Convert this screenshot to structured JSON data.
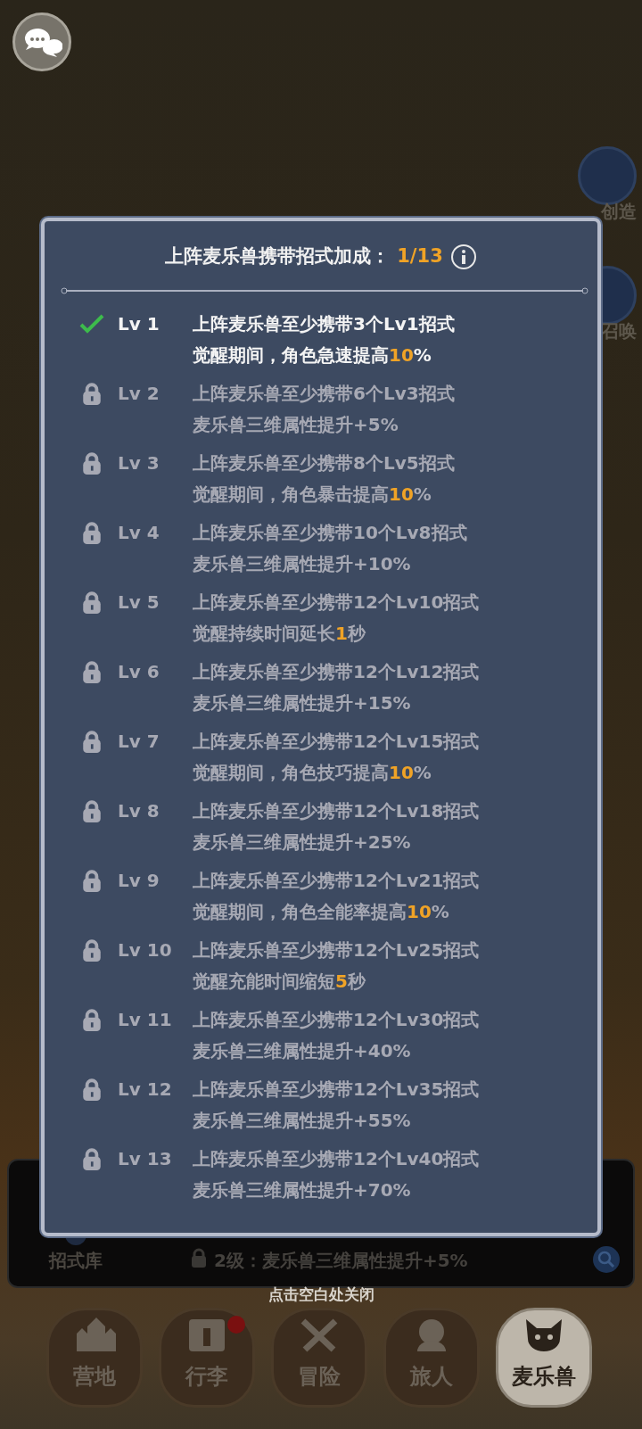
{
  "side_buttons": [
    {
      "label": "创造"
    },
    {
      "label": "召唤"
    }
  ],
  "modal": {
    "title": "上阵麦乐兽携带招式加成：",
    "progress": "1/13",
    "levels": [
      {
        "level": "Lv 1",
        "unlocked": true,
        "requirement": "上阵麦乐兽至少携带3个Lv1招式",
        "effect": [
          {
            "text": "觉醒期间，角色急速提高",
            "highlight": false
          },
          {
            "text": "10",
            "highlight": true
          },
          {
            "text": "%",
            "highlight": false
          }
        ]
      },
      {
        "level": "Lv 2",
        "unlocked": false,
        "requirement": "上阵麦乐兽至少携带6个Lv3招式",
        "effect": [
          {
            "text": "麦乐兽三维属性提升+5%",
            "highlight": false
          }
        ]
      },
      {
        "level": "Lv 3",
        "unlocked": false,
        "requirement": "上阵麦乐兽至少携带8个Lv5招式",
        "effect": [
          {
            "text": "觉醒期间，角色暴击提高",
            "highlight": false
          },
          {
            "text": "10",
            "highlight": true
          },
          {
            "text": "%",
            "highlight": false
          }
        ]
      },
      {
        "level": "Lv 4",
        "unlocked": false,
        "requirement": "上阵麦乐兽至少携带10个Lv8招式",
        "effect": [
          {
            "text": "麦乐兽三维属性提升+10%",
            "highlight": false
          }
        ]
      },
      {
        "level": "Lv 5",
        "unlocked": false,
        "requirement": "上阵麦乐兽至少携带12个Lv10招式",
        "effect": [
          {
            "text": "觉醒持续时间延长",
            "highlight": false
          },
          {
            "text": "1",
            "highlight": true
          },
          {
            "text": "秒",
            "highlight": false
          }
        ]
      },
      {
        "level": "Lv 6",
        "unlocked": false,
        "requirement": "上阵麦乐兽至少携带12个Lv12招式",
        "effect": [
          {
            "text": "麦乐兽三维属性提升+15%",
            "highlight": false
          }
        ]
      },
      {
        "level": "Lv 7",
        "unlocked": false,
        "requirement": "上阵麦乐兽至少携带12个Lv15招式",
        "effect": [
          {
            "text": "觉醒期间，角色技巧提高",
            "highlight": false
          },
          {
            "text": "10",
            "highlight": true
          },
          {
            "text": "%",
            "highlight": false
          }
        ]
      },
      {
        "level": "Lv 8",
        "unlocked": false,
        "requirement": "上阵麦乐兽至少携带12个Lv18招式",
        "effect": [
          {
            "text": "麦乐兽三维属性提升+25%",
            "highlight": false
          }
        ]
      },
      {
        "level": "Lv 9",
        "unlocked": false,
        "requirement": "上阵麦乐兽至少携带12个Lv21招式",
        "effect": [
          {
            "text": "觉醒期间，角色全能率提高",
            "highlight": false
          },
          {
            "text": "10",
            "highlight": true
          },
          {
            "text": "%",
            "highlight": false
          }
        ]
      },
      {
        "level": "Lv 10",
        "unlocked": false,
        "requirement": "上阵麦乐兽至少携带12个Lv25招式",
        "effect": [
          {
            "text": "觉醒充能时间缩短",
            "highlight": false
          },
          {
            "text": "5",
            "highlight": true
          },
          {
            "text": "秒",
            "highlight": false
          }
        ]
      },
      {
        "level": "Lv 11",
        "unlocked": false,
        "requirement": "上阵麦乐兽至少携带12个Lv30招式",
        "effect": [
          {
            "text": "麦乐兽三维属性提升+40%",
            "highlight": false
          }
        ]
      },
      {
        "level": "Lv 12",
        "unlocked": false,
        "requirement": "上阵麦乐兽至少携带12个Lv35招式",
        "effect": [
          {
            "text": "麦乐兽三维属性提升+55%",
            "highlight": false
          }
        ]
      },
      {
        "level": "Lv 13",
        "unlocked": false,
        "requirement": "上阵麦乐兽至少携带12个Lv40招式",
        "effect": [
          {
            "text": "麦乐兽三维属性提升+70%",
            "highlight": false
          }
        ]
      }
    ]
  },
  "skill_panel": {
    "library_label": "招式库",
    "bonus_line": "2级：麦乐兽三维属性提升+5%",
    "bonus_locked": true
  },
  "close_hint": "点击空白处关闭",
  "nav": [
    {
      "kind": "camp",
      "label": "营地",
      "selected": false,
      "badge": false
    },
    {
      "kind": "bag",
      "label": "行李",
      "selected": false,
      "badge": true
    },
    {
      "kind": "adventure",
      "label": "冒险",
      "selected": false,
      "badge": false
    },
    {
      "kind": "traveler",
      "label": "旅人",
      "selected": false,
      "badge": false
    },
    {
      "kind": "pet",
      "label": "麦乐兽",
      "selected": true,
      "badge": false
    }
  ]
}
